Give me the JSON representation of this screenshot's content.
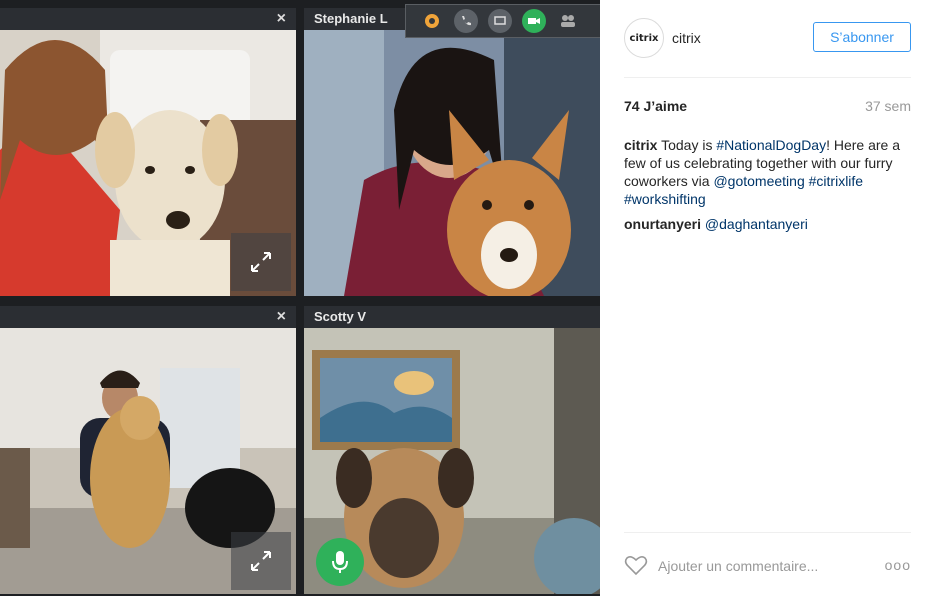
{
  "video_call": {
    "tiles": [
      {
        "name": "",
        "show_close": true,
        "show_expand": true
      },
      {
        "name": "Stephanie L",
        "show_close": false,
        "show_expand": false
      },
      {
        "name": "",
        "show_close": true,
        "show_expand": true
      },
      {
        "name": "Scotty V",
        "show_close": false,
        "show_expand": false
      }
    ],
    "close_glyph": "×",
    "toolbar_icons": [
      "gear-icon",
      "phone-icon",
      "screen-icon",
      "camera-icon",
      "people-icon"
    ]
  },
  "post": {
    "account": "citrix",
    "logo_text": "citrix",
    "follow_label": "S’abonner",
    "likes": "74 J’aime",
    "time": "37 sem",
    "caption": {
      "user": "citrix",
      "t1": " Today is ",
      "h1": "#NationalDogDay",
      "t2": "! Here are a few of us celebrating together with our furry coworkers via ",
      "m1": "@gotomeeting",
      "t3": " ",
      "h2": "#citrixlife",
      "t4": " ",
      "h3": "#workshifting"
    },
    "comment": {
      "user": "onurtanyeri",
      "mention": "@daghantanyeri"
    },
    "add_comment_placeholder": "Ajouter un commentaire...",
    "more_label": "ooo"
  },
  "colors": {
    "follow": "#3897f0",
    "link": "#003569",
    "mic": "#2fb15a"
  }
}
